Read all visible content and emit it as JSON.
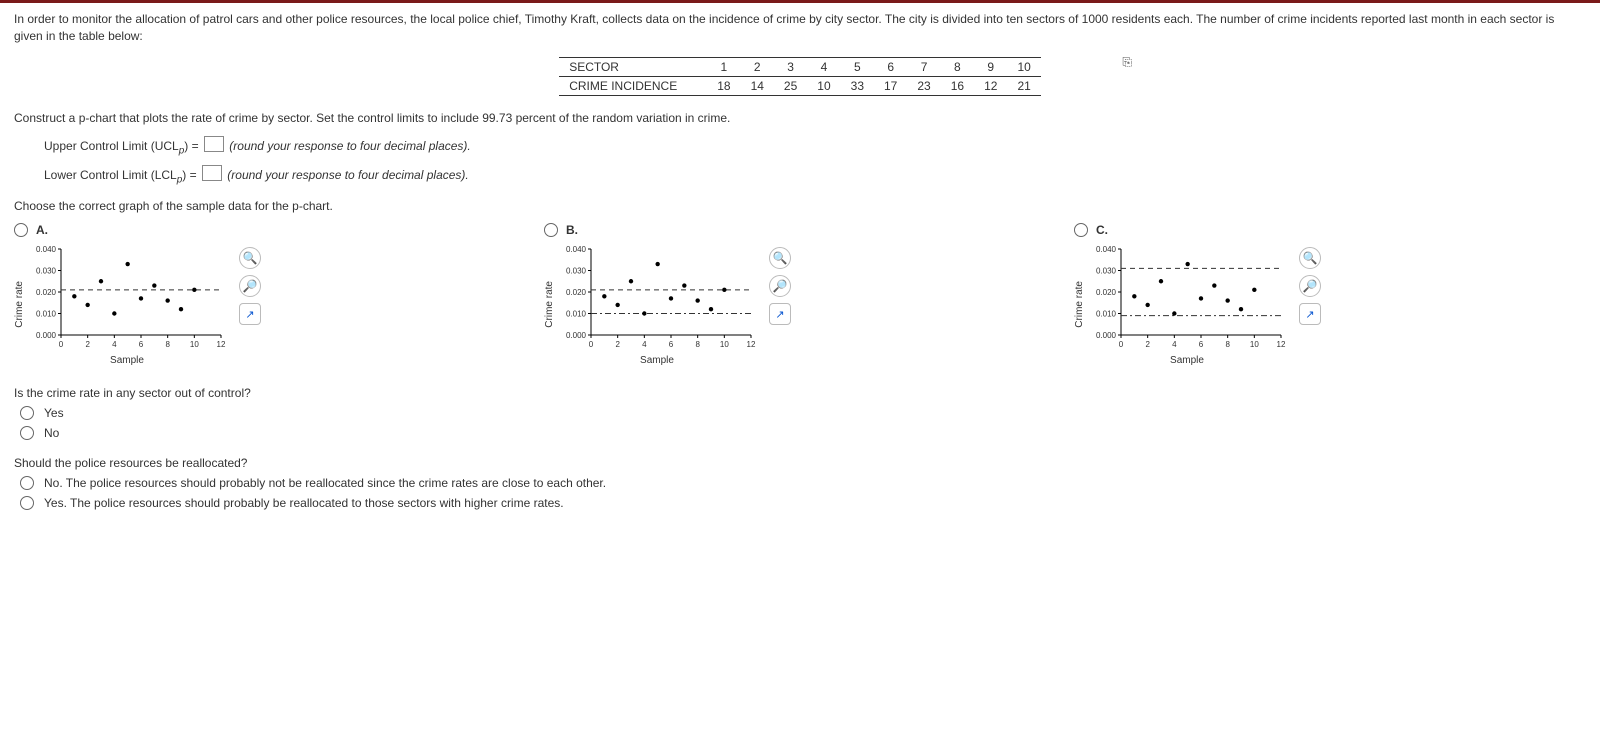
{
  "problem_intro": "In order to monitor the allocation of patrol cars and other police resources, the local police chief, Timothy Kraft, collects data on the incidence of crime by city sector. The city is divided into ten sectors of 1000 residents each. The number of crime incidents reported last month in each sector is given in the table below:",
  "table": {
    "row1_label": "SECTOR",
    "row2_label": "CRIME INCIDENCE",
    "sector_nums": [
      "1",
      "2",
      "3",
      "4",
      "5",
      "6",
      "7",
      "8",
      "9",
      "10"
    ],
    "crime_vals": [
      "18",
      "14",
      "25",
      "10",
      "33",
      "17",
      "23",
      "16",
      "12",
      "21"
    ]
  },
  "construct": "Construct a p-chart that plots the rate of crime by sector. Set the control limits to include 99.73 percent of the random variation in crime.",
  "ucl_label": "Upper Control Limit (UCL",
  "lcl_label": "Lower Control Limit (LCL",
  "sub_p": "p",
  "eq": ") = ",
  "round_hint": " (round your response to four decimal places).",
  "choose_graph": "Choose the correct graph of the sample data for the p-chart.",
  "options": {
    "a": "A.",
    "b": "B.",
    "c": "C."
  },
  "axis": {
    "y": "Crime rate",
    "x": "Sample",
    "y_ticks": [
      "0.040",
      "0.030",
      "0.020",
      "0.010",
      "0.000"
    ],
    "x_ticks": [
      "0",
      "2",
      "4",
      "6",
      "8",
      "10",
      "12"
    ]
  },
  "chart_data": [
    {
      "id": "A",
      "type": "scatter",
      "xlabel": "Sample",
      "ylabel": "Crime rate",
      "xlim": [
        0,
        12
      ],
      "ylim": [
        0.0,
        0.04
      ],
      "points": [
        [
          1,
          0.018
        ],
        [
          2,
          0.014
        ],
        [
          3,
          0.025
        ],
        [
          4,
          0.01
        ],
        [
          5,
          0.033
        ],
        [
          6,
          0.017
        ],
        [
          7,
          0.023
        ],
        [
          8,
          0.016
        ],
        [
          9,
          0.012
        ],
        [
          10,
          0.021
        ]
      ],
      "lines": [
        {
          "y": 0.021,
          "style": "dashed"
        }
      ]
    },
    {
      "id": "B",
      "type": "scatter",
      "xlabel": "Sample",
      "ylabel": "Crime rate",
      "xlim": [
        0,
        12
      ],
      "ylim": [
        0.0,
        0.04
      ],
      "points": [
        [
          1,
          0.018
        ],
        [
          2,
          0.014
        ],
        [
          3,
          0.025
        ],
        [
          4,
          0.01
        ],
        [
          5,
          0.033
        ],
        [
          6,
          0.017
        ],
        [
          7,
          0.023
        ],
        [
          8,
          0.016
        ],
        [
          9,
          0.012
        ],
        [
          10,
          0.021
        ]
      ],
      "lines": [
        {
          "y": 0.021,
          "style": "dashed"
        },
        {
          "y": 0.01,
          "style": "dashdot"
        }
      ]
    },
    {
      "id": "C",
      "type": "scatter",
      "xlabel": "Sample",
      "ylabel": "Crime rate",
      "xlim": [
        0,
        12
      ],
      "ylim": [
        0.0,
        0.04
      ],
      "points": [
        [
          1,
          0.018
        ],
        [
          2,
          0.014
        ],
        [
          3,
          0.025
        ],
        [
          4,
          0.01
        ],
        [
          5,
          0.033
        ],
        [
          6,
          0.017
        ],
        [
          7,
          0.023
        ],
        [
          8,
          0.016
        ],
        [
          9,
          0.012
        ],
        [
          10,
          0.021
        ]
      ],
      "lines": [
        {
          "y": 0.031,
          "style": "dashed"
        },
        {
          "y": 0.009,
          "style": "dashdot"
        }
      ]
    }
  ],
  "q_out": "Is the crime rate in any sector out of control?",
  "yes": "Yes",
  "no": "No",
  "q_realloc": "Should the police resources be reallocated?",
  "realloc_no": "No. The police resources should probably not be reallocated since the crime rates are close to each other.",
  "realloc_yes": "Yes. The police resources should probably be reallocated to those sectors with higher crime rates."
}
